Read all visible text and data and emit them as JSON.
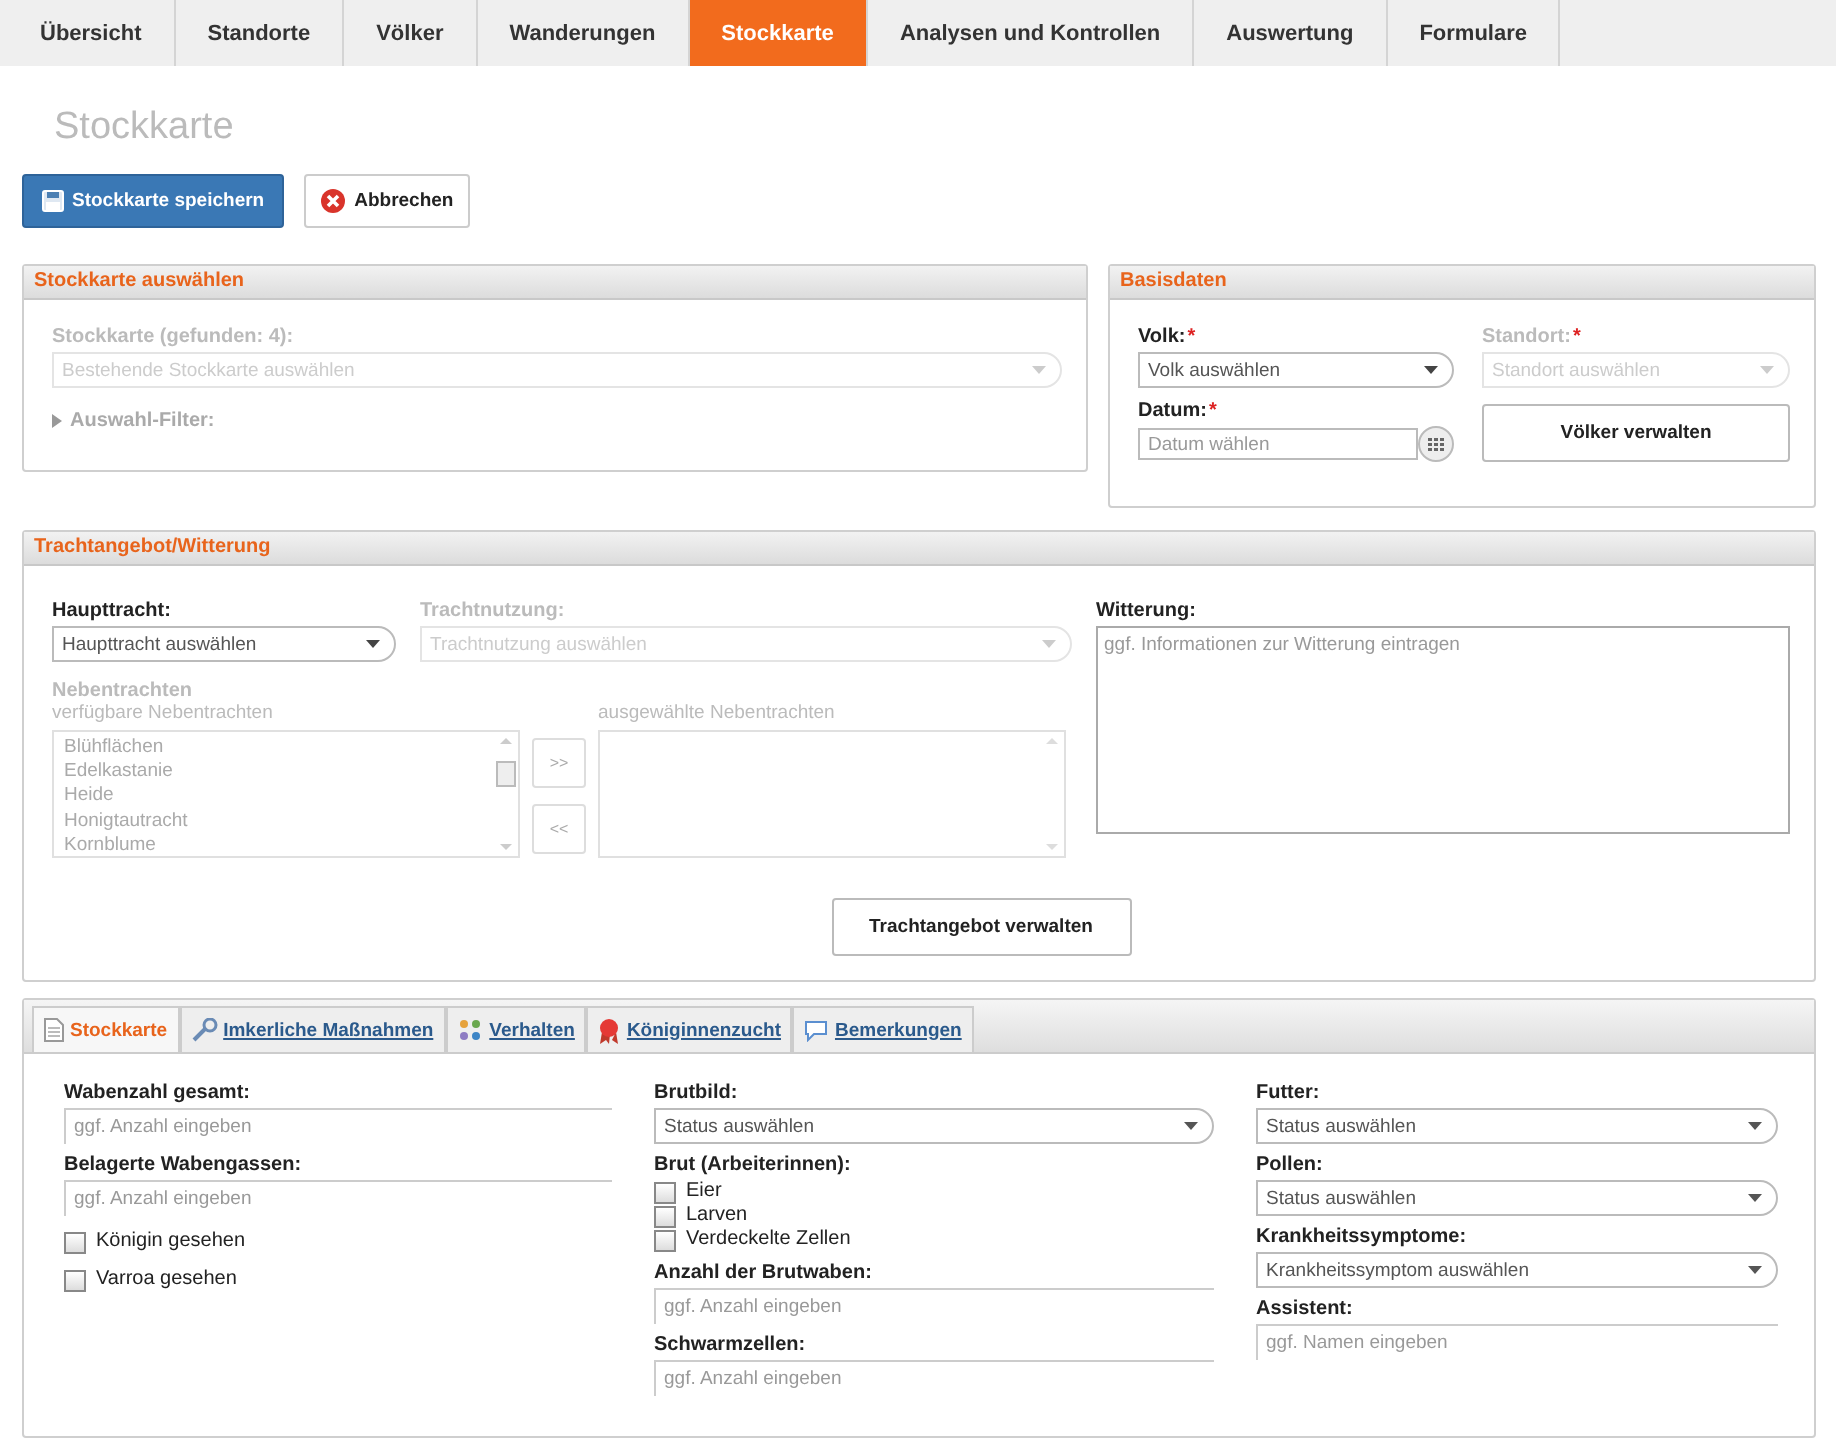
{
  "nav_tabs": [
    {
      "label": "Übersicht",
      "selected": false
    },
    {
      "label": "Standorte",
      "selected": false
    },
    {
      "label": "Völker",
      "selected": false
    },
    {
      "label": "Wanderungen",
      "selected": false
    },
    {
      "label": "Stockkarte",
      "selected": true
    },
    {
      "label": "Analysen und Kontrollen",
      "selected": false
    },
    {
      "label": "Auswertung",
      "selected": false
    },
    {
      "label": "Formulare",
      "selected": false
    }
  ],
  "page_title": "Stockkarte",
  "actions": {
    "save": "Stockkarte speichern",
    "cancel": "Abbrechen"
  },
  "select_panel": {
    "title": "Stockkarte auswählen",
    "field": {
      "label": "Stockkarte (gefunden: 4):",
      "placeholder": "Bestehende Stockkarte auswählen",
      "disabled": true
    },
    "filter_label": "Auswahl-Filter:"
  },
  "basis_panel": {
    "title": "Basisdaten",
    "volk": {
      "label": "Volk:",
      "required_mark": "*",
      "placeholder": "Volk auswählen",
      "disabled": false
    },
    "standort": {
      "label": "Standort:",
      "required_mark": "*",
      "placeholder": "Standort auswählen",
      "disabled": true
    },
    "datum": {
      "label": "Datum:",
      "required_mark": "*",
      "placeholder": "Datum wählen"
    },
    "manage_button": "Völker verwalten"
  },
  "tracht_panel": {
    "title": "Trachtangebot/Witterung",
    "haupttracht": {
      "label": "Haupttracht:",
      "placeholder": "Haupttracht auswählen",
      "disabled": false
    },
    "trachtnutzung": {
      "label": "Trachtnutzung:",
      "placeholder": "Trachtnutzung auswählen",
      "disabled": true
    },
    "nebentrachten_label": "Nebentrachten",
    "available_label": "verfügbare Nebentrachten",
    "available": [
      "Blühflächen",
      "Edelkastanie",
      "Heide",
      "Honigtautracht",
      "Kornblume"
    ],
    "add_button": ">>",
    "remove_button": "<<",
    "selected_label": "ausgewählte Nebentrachten",
    "witterung": {
      "label": "Witterung:",
      "placeholder": "ggf. Informationen zur Witterung eintragen"
    },
    "manage_button": "Trachtangebot verwalten"
  },
  "sub_tabs": [
    {
      "label": "Stockkarte",
      "selected": true
    },
    {
      "label": "Imkerliche Maßnahmen",
      "selected": false
    },
    {
      "label": "Verhalten",
      "selected": false
    },
    {
      "label": "Königinnenzucht",
      "selected": false
    },
    {
      "label": "Bemerkungen",
      "selected": false
    }
  ],
  "form_columns": [
    [
      {
        "kind": "text",
        "label": "Wabenzahl gesamt:",
        "placeholder": "ggf. Anzahl eingeben"
      },
      {
        "kind": "text",
        "label": "Belagerte Wabengassen:",
        "placeholder": "ggf. Anzahl eingeben"
      },
      {
        "kind": "checkbox",
        "label": "Königin gesehen",
        "checked": false
      },
      {
        "kind": "checkbox",
        "label": "Varroa gesehen",
        "checked": false
      }
    ],
    [
      {
        "kind": "select",
        "label": "Brutbild:",
        "placeholder": "Status auswählen"
      },
      {
        "kind": "checkgroup",
        "label": "Brut (Arbeiterinnen):",
        "options": [
          {
            "label": "Eier",
            "checked": false
          },
          {
            "label": "Larven",
            "checked": false
          },
          {
            "label": "Verdeckelte Zellen",
            "checked": false
          }
        ]
      },
      {
        "kind": "text",
        "label": "Anzahl der Brutwaben:",
        "placeholder": "ggf. Anzahl eingeben"
      },
      {
        "kind": "text",
        "label": "Schwarmzellen:",
        "placeholder": "ggf. Anzahl eingeben"
      }
    ],
    [
      {
        "kind": "select",
        "label": "Futter:",
        "placeholder": "Status auswählen"
      },
      {
        "kind": "select",
        "label": "Pollen:",
        "placeholder": "Status auswählen"
      },
      {
        "kind": "select",
        "label": "Krankheitssymptome:",
        "placeholder": "Krankheitssymptom auswählen"
      },
      {
        "kind": "text",
        "label": "Assistent:",
        "placeholder": "ggf. Namen eingeben"
      }
    ]
  ]
}
